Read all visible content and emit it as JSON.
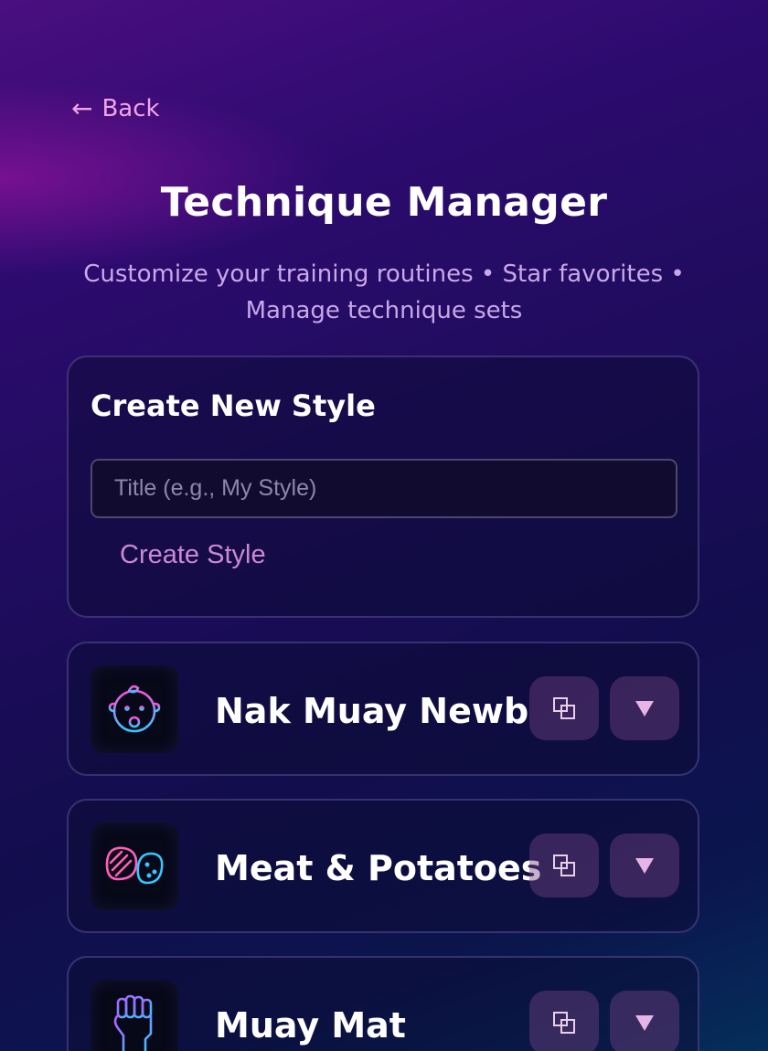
{
  "nav": {
    "back_arrow": "←",
    "back_label": "Back"
  },
  "header": {
    "title": "Technique Manager",
    "subtitle_line1": "Customize your training routines • Star favorites •",
    "subtitle_line2": "Manage technique sets"
  },
  "create": {
    "heading": "Create New Style",
    "title_placeholder": "Title (e.g., My Style)",
    "title_value": "",
    "button_label": "Create Style"
  },
  "styles": [
    {
      "name": "Nak Muay Newb",
      "icon": "baby-icon"
    },
    {
      "name": "Meat & Potatoes",
      "icon": "meat-potato-icon"
    },
    {
      "name": "Muay Mat",
      "icon": "raised-fist-icon"
    }
  ],
  "actions": {
    "copy_icon": "duplicate-icon",
    "expand_icon": "chevron-down-icon"
  },
  "colors": {
    "accent_pink": "#f0a6e8",
    "button_pink": "#c98ad0",
    "neon_pink": "#ff4fd8",
    "neon_cyan": "#35c8ff"
  }
}
